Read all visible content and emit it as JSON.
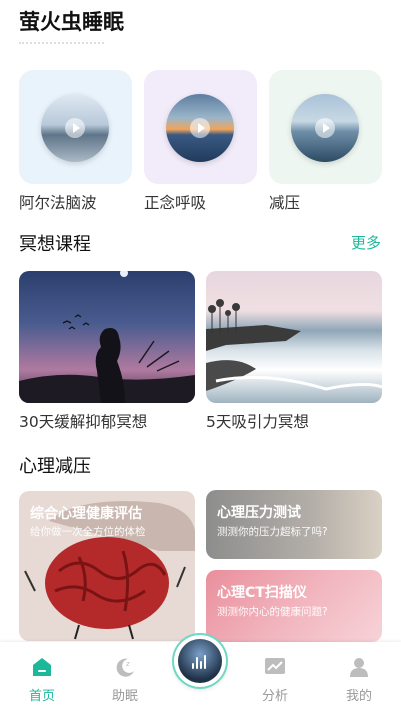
{
  "header": {
    "title": "萤火虫睡眠"
  },
  "features": [
    {
      "label": "阿尔法脑波"
    },
    {
      "label": "正念呼吸"
    },
    {
      "label": "减压"
    }
  ],
  "meditation": {
    "title": "冥想课程",
    "more_label": "更多",
    "courses": [
      {
        "label": "30天缓解抑郁冥想"
      },
      {
        "label": "5天吸引力冥想"
      }
    ]
  },
  "relief": {
    "title": "心理减压",
    "tiles": [
      {
        "title": "综合心理健康评估",
        "subtitle": "给你做一次全方位的体检"
      },
      {
        "title": "心理压力测试",
        "subtitle": "测测你的压力超标了吗?"
      },
      {
        "title": "心理CT扫描仪",
        "subtitle": "测测你内心的健康问题?"
      }
    ]
  },
  "nav": {
    "items": [
      {
        "label": "首页",
        "icon": "home-icon",
        "active": true
      },
      {
        "label": "助眠",
        "icon": "moon-icon"
      },
      {
        "label": "分析",
        "icon": "chart-icon"
      },
      {
        "label": "我的",
        "icon": "user-icon"
      }
    ],
    "center_icon": "sound-wave-icon"
  },
  "colors": {
    "accent": "#1bb89a"
  }
}
